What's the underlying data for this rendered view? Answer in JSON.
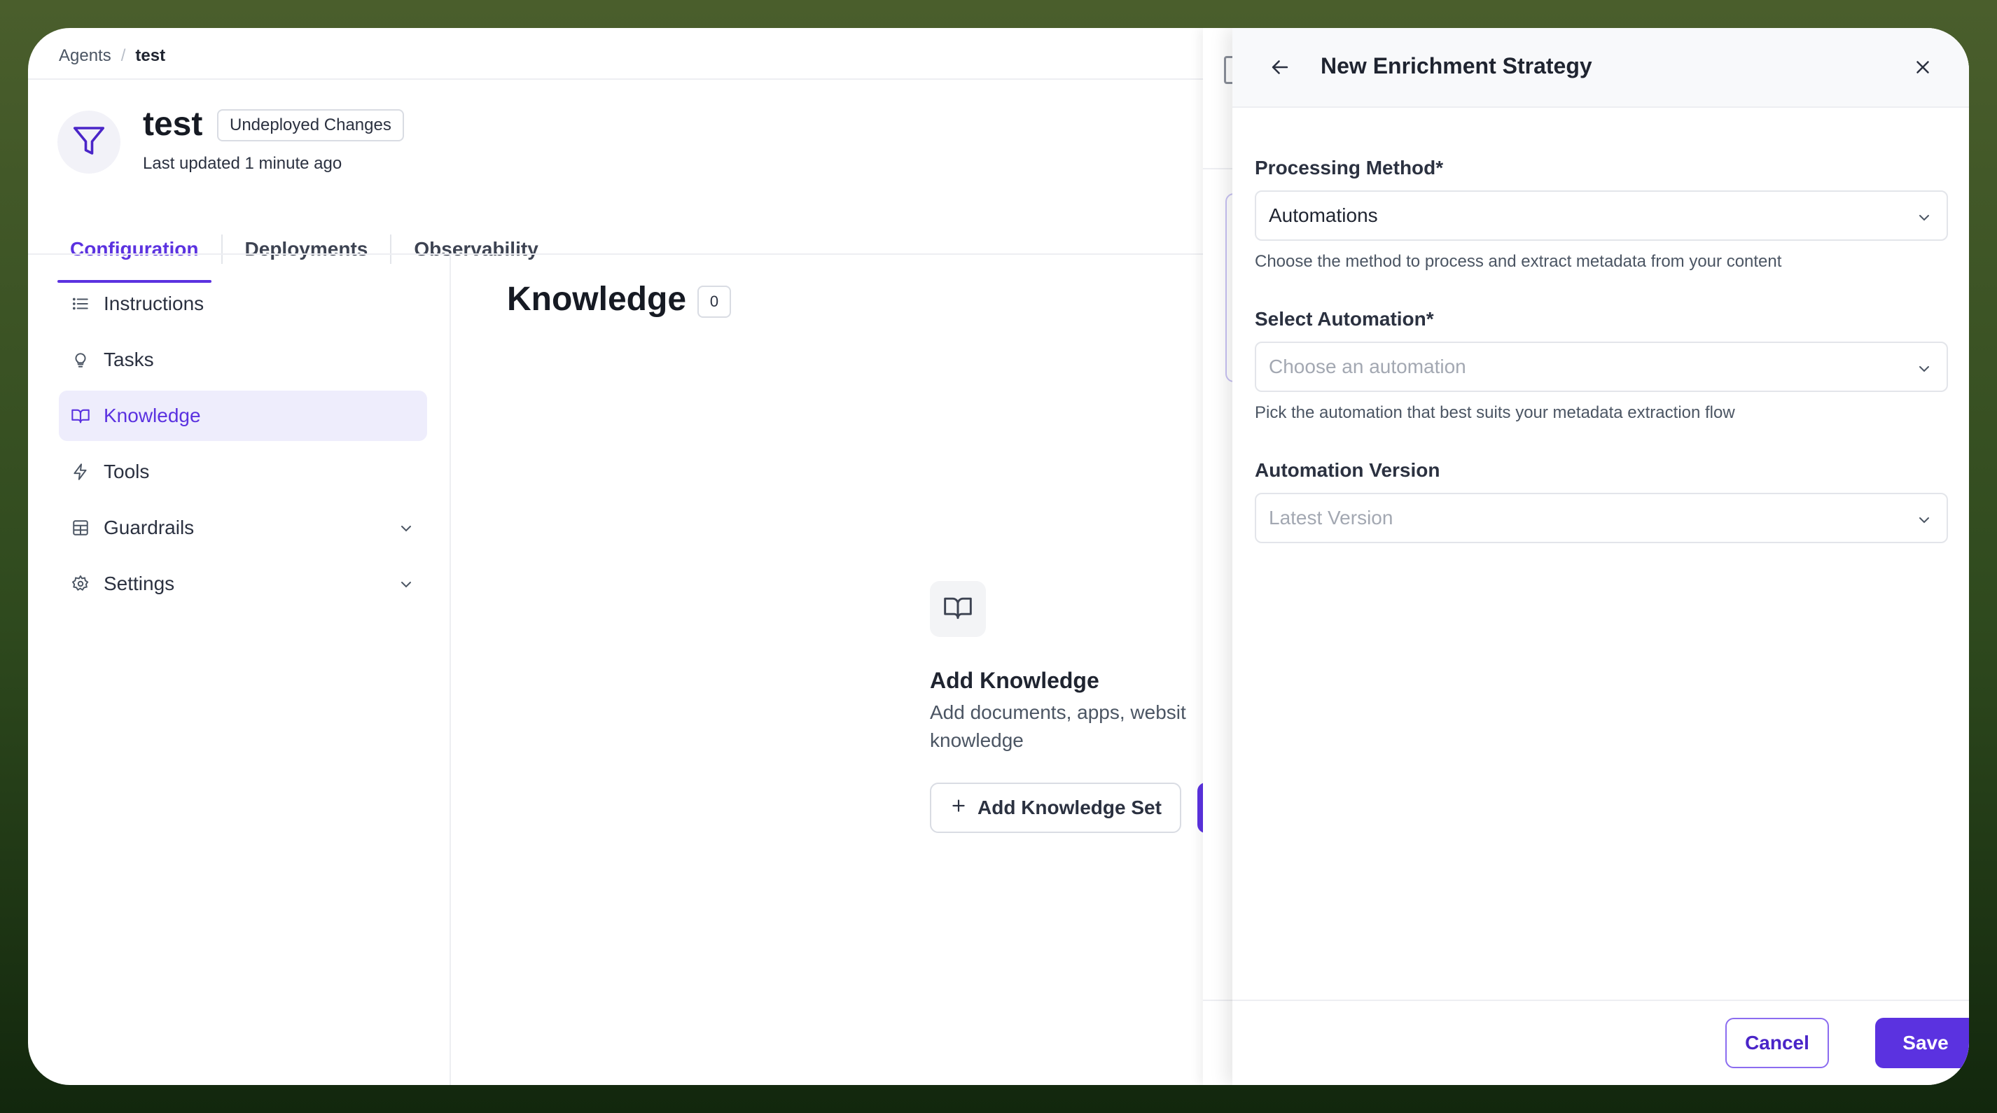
{
  "breadcrumb": {
    "root": "Agents",
    "separator": "/",
    "current": "test"
  },
  "agent": {
    "name": "test",
    "badge": "Undeployed Changes",
    "last_updated": "Last updated 1 minute ago",
    "avatar_icon": "funnel-icon"
  },
  "tabs": [
    {
      "label": "Configuration",
      "active": true
    },
    {
      "label": "Deployments",
      "active": false
    },
    {
      "label": "Observability",
      "active": false
    }
  ],
  "sidebar": {
    "items": [
      {
        "label": "Instructions",
        "icon": "list-icon",
        "active": false
      },
      {
        "label": "Tasks",
        "icon": "lightbulb-icon",
        "active": false
      },
      {
        "label": "Knowledge",
        "icon": "book-icon",
        "active": true
      },
      {
        "label": "Tools",
        "icon": "lightning-icon",
        "active": false
      },
      {
        "label": "Guardrails",
        "icon": "table-icon",
        "active": false,
        "expandable": true
      },
      {
        "label": "Settings",
        "icon": "gear-icon",
        "active": false,
        "expandable": true
      }
    ]
  },
  "knowledge": {
    "title": "Knowledge",
    "count": "0",
    "empty_title": "Add Knowledge",
    "empty_desc_line1": "Add documents, apps, websit",
    "empty_desc_line2": "knowledge",
    "add_set_label": "Add Knowledge Set"
  },
  "drawer": {
    "title": "New Enrichment Strategy",
    "processing_method": {
      "label": "Processing Method*",
      "value": "Automations",
      "helper": "Choose the method to process and extract metadata from your content"
    },
    "select_automation": {
      "label": "Select Automation*",
      "placeholder": "Choose an automation",
      "helper": "Pick the automation that best suits your metadata extraction flow"
    },
    "automation_version": {
      "label": "Automation Version",
      "placeholder": "Latest Version"
    },
    "cancel_label": "Cancel",
    "save_label": "Save"
  },
  "colors": {
    "accent": "#5b32e0",
    "accent_soft": "#eeedfc",
    "background_top": "#4a5e2c",
    "background_bottom": "#12270d"
  }
}
